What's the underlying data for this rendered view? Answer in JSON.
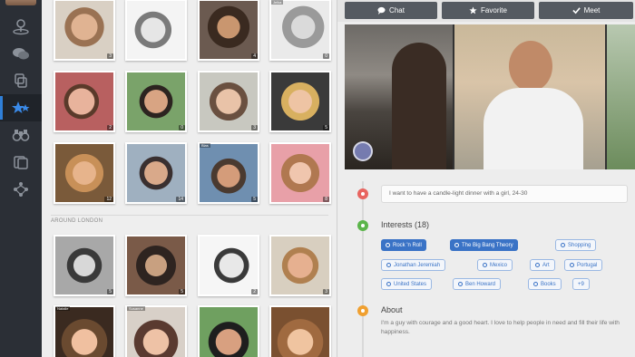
{
  "nav": {
    "items": [
      {
        "icon": "avatar-icon"
      },
      {
        "icon": "location-icon"
      },
      {
        "icon": "messages-icon"
      },
      {
        "icon": "stack-icon"
      },
      {
        "icon": "favorites-icon"
      },
      {
        "icon": "binoculars-icon"
      },
      {
        "icon": "cards-icon"
      },
      {
        "icon": "tree-icon"
      }
    ],
    "active_index": 4
  },
  "grid": {
    "top_tiles": [
      {
        "name": "",
        "count": "3"
      },
      {
        "name": "",
        "count": ""
      },
      {
        "name": "",
        "count": "4"
      },
      {
        "name": "Jelka",
        "count": "0"
      },
      {
        "name": "",
        "count": "2"
      },
      {
        "name": "",
        "count": "0"
      },
      {
        "name": "",
        "count": "3"
      },
      {
        "name": "",
        "count": "5"
      },
      {
        "name": "",
        "count": "12"
      },
      {
        "name": "",
        "count": "14"
      },
      {
        "name": "Blas",
        "count": "5"
      },
      {
        "name": "",
        "count": "8"
      }
    ],
    "section_label": "AROUND LONDON",
    "bottom_tiles": [
      {
        "name": "",
        "count": "5"
      },
      {
        "name": "",
        "count": "5"
      },
      {
        "name": "",
        "count": "2"
      },
      {
        "name": "",
        "count": "3"
      },
      {
        "name": "Natalie",
        "count": ""
      },
      {
        "name": "Susanne",
        "count": ""
      },
      {
        "name": "",
        "count": ""
      },
      {
        "name": "",
        "count": ""
      }
    ]
  },
  "profile": {
    "actions": [
      {
        "label": "Chat",
        "icon": "chat-icon"
      },
      {
        "label": "Favorite",
        "icon": "star-icon"
      },
      {
        "label": "Meet",
        "icon": "check-icon"
      }
    ],
    "photo_badge": "",
    "status": "I want to have a candle-light dinner with a girl, 24-30",
    "interests_title": "Interests (18)",
    "interests": [
      {
        "label": "Rock 'n Roll",
        "style": "filled"
      },
      {
        "label": "The Big Bang Theory",
        "style": "filled"
      },
      {
        "label": "Shopping",
        "style": "outline"
      },
      {
        "label": "Jonathan Jeremiah",
        "style": "outline"
      },
      {
        "label": "Mexico",
        "style": "outline"
      },
      {
        "label": "Art",
        "style": "outline"
      },
      {
        "label": "Portugal",
        "style": "outline"
      },
      {
        "label": "United States",
        "style": "outline"
      },
      {
        "label": "Ben Howard",
        "style": "outline"
      },
      {
        "label": "Books",
        "style": "outline"
      },
      {
        "label": "+9",
        "style": "outline"
      }
    ],
    "about_title": "About",
    "about_text": "I'm a guy with courage and a good heart. I love to help people in need and fill their life with happiness.",
    "colors": {
      "status_dot": "#e8645f",
      "interests_dot": "#5bb54a",
      "about_dot": "#f0a030",
      "accent": "#3a73c6"
    }
  }
}
